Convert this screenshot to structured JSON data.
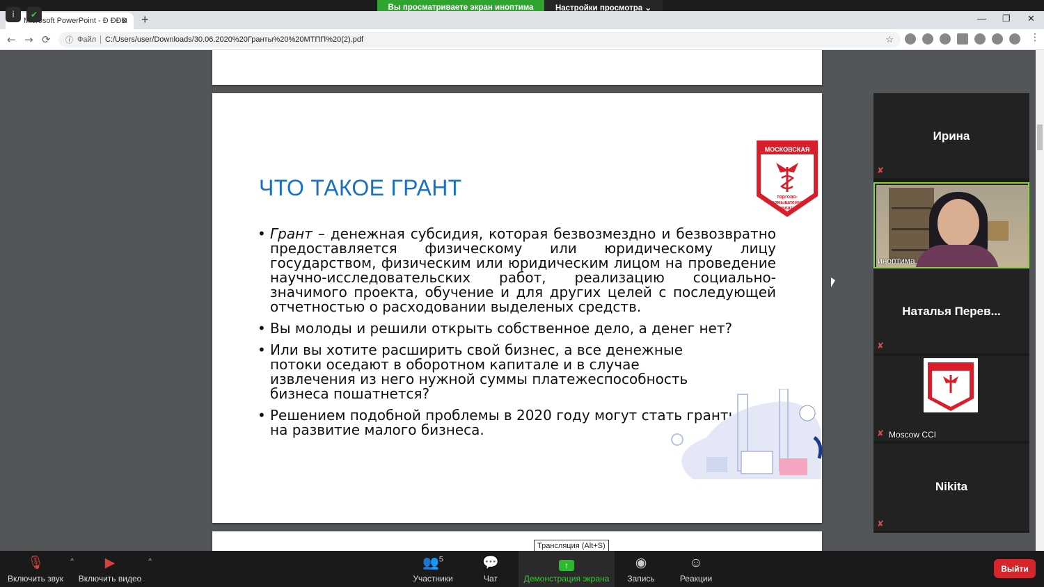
{
  "zoom_banner": {
    "sharing_text": "Вы просматриваете экран иноптима",
    "view_options": "Настройки просмотра ⌄"
  },
  "browser": {
    "tab_title": "Microsoft PowerPoint - Ð ÐÐÐ",
    "tab_close": "✕",
    "new_tab": "+",
    "minimize": "—",
    "restore": "❐",
    "close": "✕",
    "back": "←",
    "forward": "→",
    "reload": "⟳",
    "info": "ⓘ",
    "file_label": "Файл",
    "url": "C:/Users/user/Downloads/30.06.2020%20Гранты%20%20МТПП%20(2).pdf",
    "star": "☆",
    "menu": "⋮"
  },
  "slide": {
    "title": "ЧТО ТАКОЕ ГРАНТ",
    "logo_text": "МОСКОВСКАЯ",
    "logo_sub": "торгово-промышленная палата",
    "bullets": [
      {
        "lead": "Грант",
        "text": " – денежная субсидия, которая безвозмездно и безвозвратно предоставляется физическому или юридическому лицу государством, физическим или юридическим лицом на проведение научно-исследовательских работ, реализацию социально-значимого проекта, обучение и для других целей с последующей отчетностью о расходовании выделеных средств."
      },
      {
        "lead": "",
        "text": "Вы молоды и решили открыть собственное дело, а денег нет?"
      },
      {
        "lead": "",
        "text": "Или вы хотите расширить свой бизнес, а все денежные потоки оседают в оборотном капитале и в случае извлечения из него нужной суммы платежеспособность бизнеса пошатнется?"
      },
      {
        "lead": "",
        "text": "Решением подобной проблемы в 2020 году могут стать гранты на развитие малого бизнеса."
      }
    ]
  },
  "gallery": {
    "participants": [
      {
        "name": "Ирина",
        "muted": true
      },
      {
        "name": "иноптима",
        "muted": false,
        "video": true
      },
      {
        "name": "Наталья  Перев...",
        "muted": true
      },
      {
        "name": "Moscow CCI",
        "muted": true
      },
      {
        "name": "Nikita",
        "muted": true
      }
    ],
    "mute_glyph": "✘"
  },
  "toolbar": {
    "unmute": "Включить звук",
    "start_video": "Включить видео",
    "participants": "Участники",
    "participants_count": "5",
    "chat": "Чат",
    "share": "Демонстрация экрана",
    "record": "Запись",
    "reactions": "Реакции",
    "leave": "Выйти",
    "caret": "^"
  },
  "tooltip": "Трансляция (Alt+S)",
  "colors": {
    "title_blue": "#1a6fc0",
    "banner_green": "#2fa52f",
    "leave_red": "#d4262c",
    "mcci_red": "#d81e2a"
  }
}
